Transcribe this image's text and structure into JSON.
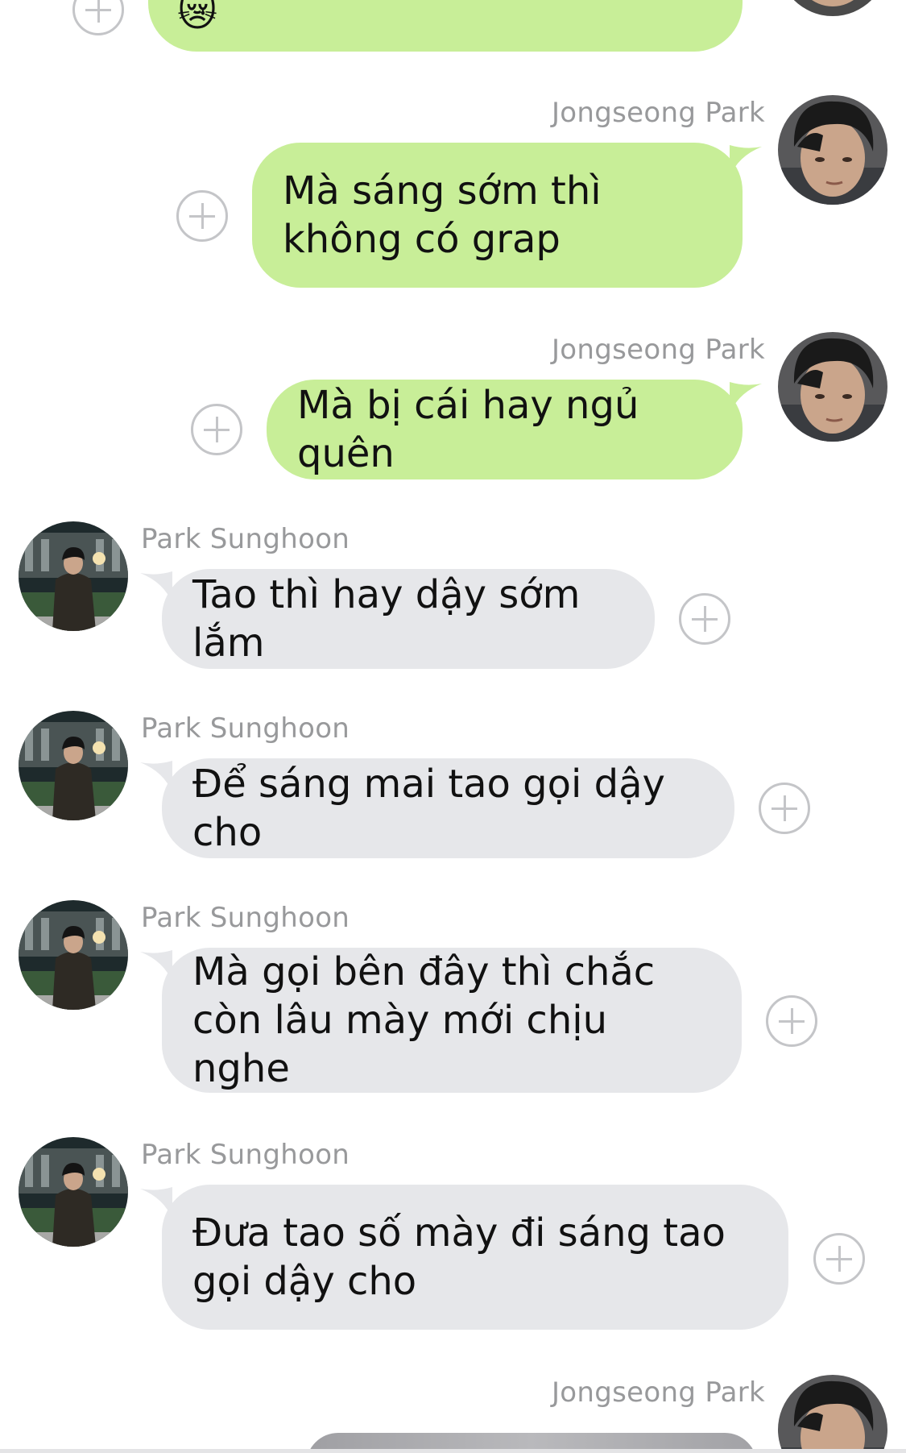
{
  "colors": {
    "outgoing_bubble": "#c8ee98",
    "incoming_bubble": "#e6e7ea",
    "sender_name": "#98999b",
    "add_icon": "#c4c5c8"
  },
  "messages": [
    {
      "direction": "outgoing",
      "sender": "",
      "text": "Đéo ai cho đi học chứ sao 😿",
      "icon": "add-reaction-icon"
    },
    {
      "direction": "outgoing",
      "sender": "Jongseong Park",
      "text": "Mà sáng sớm thì không có grap",
      "icon": "add-reaction-icon"
    },
    {
      "direction": "outgoing",
      "sender": "Jongseong Park",
      "text": "Mà bị cái hay ngủ quên",
      "icon": "add-reaction-icon"
    },
    {
      "direction": "incoming",
      "sender": "Park Sunghoon",
      "text": "Tao thì hay dậy sớm lắm",
      "icon": "add-reaction-icon"
    },
    {
      "direction": "incoming",
      "sender": "Park Sunghoon",
      "text": "Để sáng mai tao gọi dậy cho",
      "icon": "add-reaction-icon"
    },
    {
      "direction": "incoming",
      "sender": "Park Sunghoon",
      "text": "Mà gọi bên đây thì chắc còn lâu mày mới chịu nghe",
      "icon": "add-reaction-icon"
    },
    {
      "direction": "incoming",
      "sender": "Park Sunghoon",
      "text": "Đưa tao số mày đi sáng tao gọi dậy cho",
      "icon": "add-reaction-icon"
    },
    {
      "direction": "outgoing",
      "sender": "Jongseong Park",
      "text": "",
      "icon": ""
    }
  ]
}
